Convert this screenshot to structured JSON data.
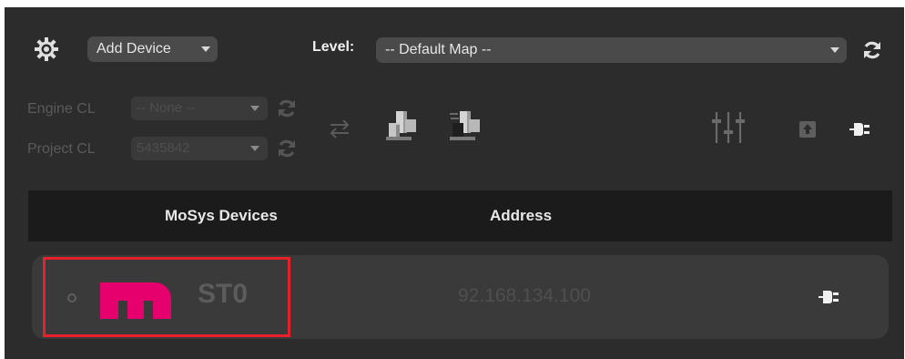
{
  "toolbar": {
    "add_device_label": "Add Device",
    "level_label": "Level:",
    "level_value": "-- Default Map --"
  },
  "changelists": {
    "engine_label": "Engine CL",
    "engine_value": "-- None --",
    "project_label": "Project CL",
    "project_value": "5435842"
  },
  "table": {
    "headers": [
      "MoSys Devices",
      "Address"
    ],
    "rows": [
      {
        "name": "ST0",
        "address": "92.168.134.100"
      }
    ]
  },
  "colors": {
    "panel_bg": "#2c2c2c",
    "header_bg": "#1b1b1b",
    "row_bg": "#3a3a3a",
    "brand_logo": "#e5006e",
    "highlight": "#e8202a"
  },
  "icons": [
    "gear-icon",
    "refresh-icon",
    "swap-icon",
    "build-icon",
    "build-alt-icon",
    "sliders-icon",
    "upload-icon",
    "plug-icon",
    "mosys-logo"
  ]
}
